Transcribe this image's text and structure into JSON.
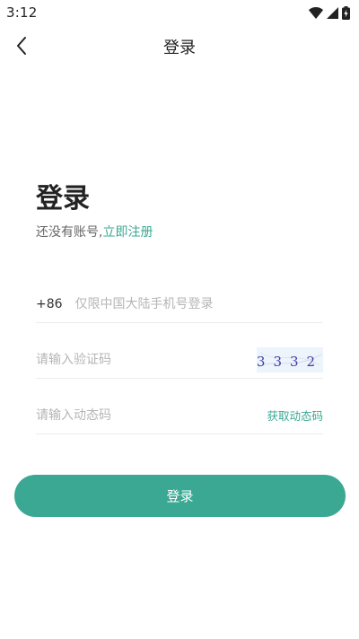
{
  "status_bar": {
    "time": "3:12",
    "icons": [
      "wifi-icon",
      "signal-icon",
      "battery-charging-icon"
    ]
  },
  "nav": {
    "back_icon": "chevron-left-icon",
    "title": "登录"
  },
  "headline": {
    "title": "登录",
    "prompt": "还没有账号,",
    "register_link": "立即注册"
  },
  "form": {
    "phone": {
      "country_code": "+86",
      "placeholder": "仅限中国大陆手机号登录",
      "value": ""
    },
    "captcha": {
      "placeholder": "请输入验证码",
      "value": "",
      "image_text": "3332"
    },
    "otp": {
      "placeholder": "请输入动态码",
      "value": "",
      "get_code_label": "获取动态码"
    }
  },
  "login_button": {
    "label": "登录"
  },
  "colors": {
    "accent": "#3aa893",
    "text_primary": "#222222",
    "text_secondary": "#666666",
    "placeholder": "#b5b5b5",
    "divider": "#ececec",
    "captcha_bg": "#eef4fb",
    "captcha_text": "#3b3ea8"
  }
}
